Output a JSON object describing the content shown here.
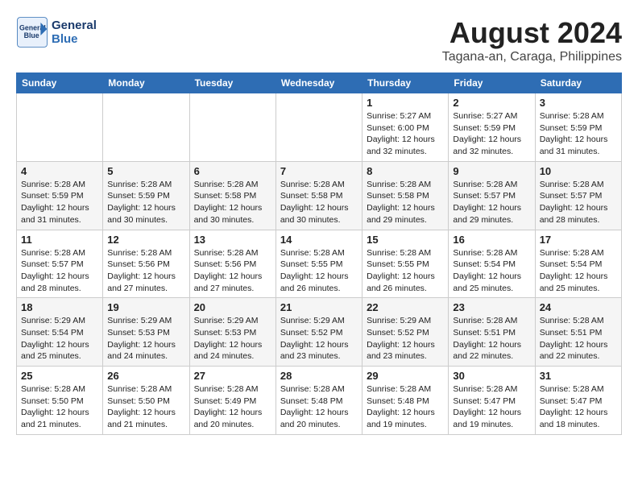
{
  "header": {
    "logo_line1": "General",
    "logo_line2": "Blue",
    "month_year": "August 2024",
    "location": "Tagana-an, Caraga, Philippines"
  },
  "weekdays": [
    "Sunday",
    "Monday",
    "Tuesday",
    "Wednesday",
    "Thursday",
    "Friday",
    "Saturday"
  ],
  "weeks": [
    [
      {
        "day": "",
        "sunrise": "",
        "sunset": "",
        "daylight": ""
      },
      {
        "day": "",
        "sunrise": "",
        "sunset": "",
        "daylight": ""
      },
      {
        "day": "",
        "sunrise": "",
        "sunset": "",
        "daylight": ""
      },
      {
        "day": "",
        "sunrise": "",
        "sunset": "",
        "daylight": ""
      },
      {
        "day": "1",
        "sunrise": "Sunrise: 5:27 AM",
        "sunset": "Sunset: 6:00 PM",
        "daylight": "Daylight: 12 hours and 32 minutes."
      },
      {
        "day": "2",
        "sunrise": "Sunrise: 5:27 AM",
        "sunset": "Sunset: 5:59 PM",
        "daylight": "Daylight: 12 hours and 32 minutes."
      },
      {
        "day": "3",
        "sunrise": "Sunrise: 5:28 AM",
        "sunset": "Sunset: 5:59 PM",
        "daylight": "Daylight: 12 hours and 31 minutes."
      }
    ],
    [
      {
        "day": "4",
        "sunrise": "Sunrise: 5:28 AM",
        "sunset": "Sunset: 5:59 PM",
        "daylight": "Daylight: 12 hours and 31 minutes."
      },
      {
        "day": "5",
        "sunrise": "Sunrise: 5:28 AM",
        "sunset": "Sunset: 5:59 PM",
        "daylight": "Daylight: 12 hours and 30 minutes."
      },
      {
        "day": "6",
        "sunrise": "Sunrise: 5:28 AM",
        "sunset": "Sunset: 5:58 PM",
        "daylight": "Daylight: 12 hours and 30 minutes."
      },
      {
        "day": "7",
        "sunrise": "Sunrise: 5:28 AM",
        "sunset": "Sunset: 5:58 PM",
        "daylight": "Daylight: 12 hours and 30 minutes."
      },
      {
        "day": "8",
        "sunrise": "Sunrise: 5:28 AM",
        "sunset": "Sunset: 5:58 PM",
        "daylight": "Daylight: 12 hours and 29 minutes."
      },
      {
        "day": "9",
        "sunrise": "Sunrise: 5:28 AM",
        "sunset": "Sunset: 5:57 PM",
        "daylight": "Daylight: 12 hours and 29 minutes."
      },
      {
        "day": "10",
        "sunrise": "Sunrise: 5:28 AM",
        "sunset": "Sunset: 5:57 PM",
        "daylight": "Daylight: 12 hours and 28 minutes."
      }
    ],
    [
      {
        "day": "11",
        "sunrise": "Sunrise: 5:28 AM",
        "sunset": "Sunset: 5:57 PM",
        "daylight": "Daylight: 12 hours and 28 minutes."
      },
      {
        "day": "12",
        "sunrise": "Sunrise: 5:28 AM",
        "sunset": "Sunset: 5:56 PM",
        "daylight": "Daylight: 12 hours and 27 minutes."
      },
      {
        "day": "13",
        "sunrise": "Sunrise: 5:28 AM",
        "sunset": "Sunset: 5:56 PM",
        "daylight": "Daylight: 12 hours and 27 minutes."
      },
      {
        "day": "14",
        "sunrise": "Sunrise: 5:28 AM",
        "sunset": "Sunset: 5:55 PM",
        "daylight": "Daylight: 12 hours and 26 minutes."
      },
      {
        "day": "15",
        "sunrise": "Sunrise: 5:28 AM",
        "sunset": "Sunset: 5:55 PM",
        "daylight": "Daylight: 12 hours and 26 minutes."
      },
      {
        "day": "16",
        "sunrise": "Sunrise: 5:28 AM",
        "sunset": "Sunset: 5:54 PM",
        "daylight": "Daylight: 12 hours and 25 minutes."
      },
      {
        "day": "17",
        "sunrise": "Sunrise: 5:28 AM",
        "sunset": "Sunset: 5:54 PM",
        "daylight": "Daylight: 12 hours and 25 minutes."
      }
    ],
    [
      {
        "day": "18",
        "sunrise": "Sunrise: 5:29 AM",
        "sunset": "Sunset: 5:54 PM",
        "daylight": "Daylight: 12 hours and 25 minutes."
      },
      {
        "day": "19",
        "sunrise": "Sunrise: 5:29 AM",
        "sunset": "Sunset: 5:53 PM",
        "daylight": "Daylight: 12 hours and 24 minutes."
      },
      {
        "day": "20",
        "sunrise": "Sunrise: 5:29 AM",
        "sunset": "Sunset: 5:53 PM",
        "daylight": "Daylight: 12 hours and 24 minutes."
      },
      {
        "day": "21",
        "sunrise": "Sunrise: 5:29 AM",
        "sunset": "Sunset: 5:52 PM",
        "daylight": "Daylight: 12 hours and 23 minutes."
      },
      {
        "day": "22",
        "sunrise": "Sunrise: 5:29 AM",
        "sunset": "Sunset: 5:52 PM",
        "daylight": "Daylight: 12 hours and 23 minutes."
      },
      {
        "day": "23",
        "sunrise": "Sunrise: 5:28 AM",
        "sunset": "Sunset: 5:51 PM",
        "daylight": "Daylight: 12 hours and 22 minutes."
      },
      {
        "day": "24",
        "sunrise": "Sunrise: 5:28 AM",
        "sunset": "Sunset: 5:51 PM",
        "daylight": "Daylight: 12 hours and 22 minutes."
      }
    ],
    [
      {
        "day": "25",
        "sunrise": "Sunrise: 5:28 AM",
        "sunset": "Sunset: 5:50 PM",
        "daylight": "Daylight: 12 hours and 21 minutes."
      },
      {
        "day": "26",
        "sunrise": "Sunrise: 5:28 AM",
        "sunset": "Sunset: 5:50 PM",
        "daylight": "Daylight: 12 hours and 21 minutes."
      },
      {
        "day": "27",
        "sunrise": "Sunrise: 5:28 AM",
        "sunset": "Sunset: 5:49 PM",
        "daylight": "Daylight: 12 hours and 20 minutes."
      },
      {
        "day": "28",
        "sunrise": "Sunrise: 5:28 AM",
        "sunset": "Sunset: 5:48 PM",
        "daylight": "Daylight: 12 hours and 20 minutes."
      },
      {
        "day": "29",
        "sunrise": "Sunrise: 5:28 AM",
        "sunset": "Sunset: 5:48 PM",
        "daylight": "Daylight: 12 hours and 19 minutes."
      },
      {
        "day": "30",
        "sunrise": "Sunrise: 5:28 AM",
        "sunset": "Sunset: 5:47 PM",
        "daylight": "Daylight: 12 hours and 19 minutes."
      },
      {
        "day": "31",
        "sunrise": "Sunrise: 5:28 AM",
        "sunset": "Sunset: 5:47 PM",
        "daylight": "Daylight: 12 hours and 18 minutes."
      }
    ]
  ],
  "colors": {
    "header_bg": "#2e6db4",
    "logo_color": "#1a3a6b",
    "accent": "#2e6db4"
  }
}
